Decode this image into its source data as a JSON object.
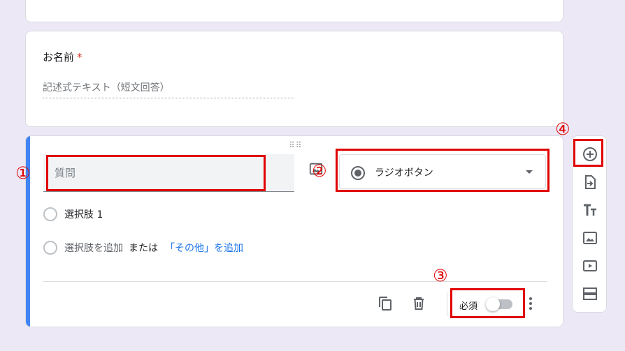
{
  "name_question": {
    "title": "お名前",
    "required_mark": "*",
    "answer_placeholder": "記述式テキスト（短文回答）"
  },
  "question_card": {
    "question_placeholder": "質問",
    "type_selected": "ラジオボタン",
    "options": [
      {
        "label": "選択肢 1"
      }
    ],
    "add_option": {
      "label": "選択肢を追加",
      "or_text": "または",
      "add_other_label": "「その他」を追加"
    },
    "footer": {
      "required_label": "必須",
      "required_on": false
    }
  },
  "annotations": [
    "①",
    "②",
    "③",
    "④"
  ],
  "colors": {
    "accent": "#4285f4",
    "annotation": "#e00000",
    "link": "#1a73e8",
    "required_star": "#d93025"
  }
}
